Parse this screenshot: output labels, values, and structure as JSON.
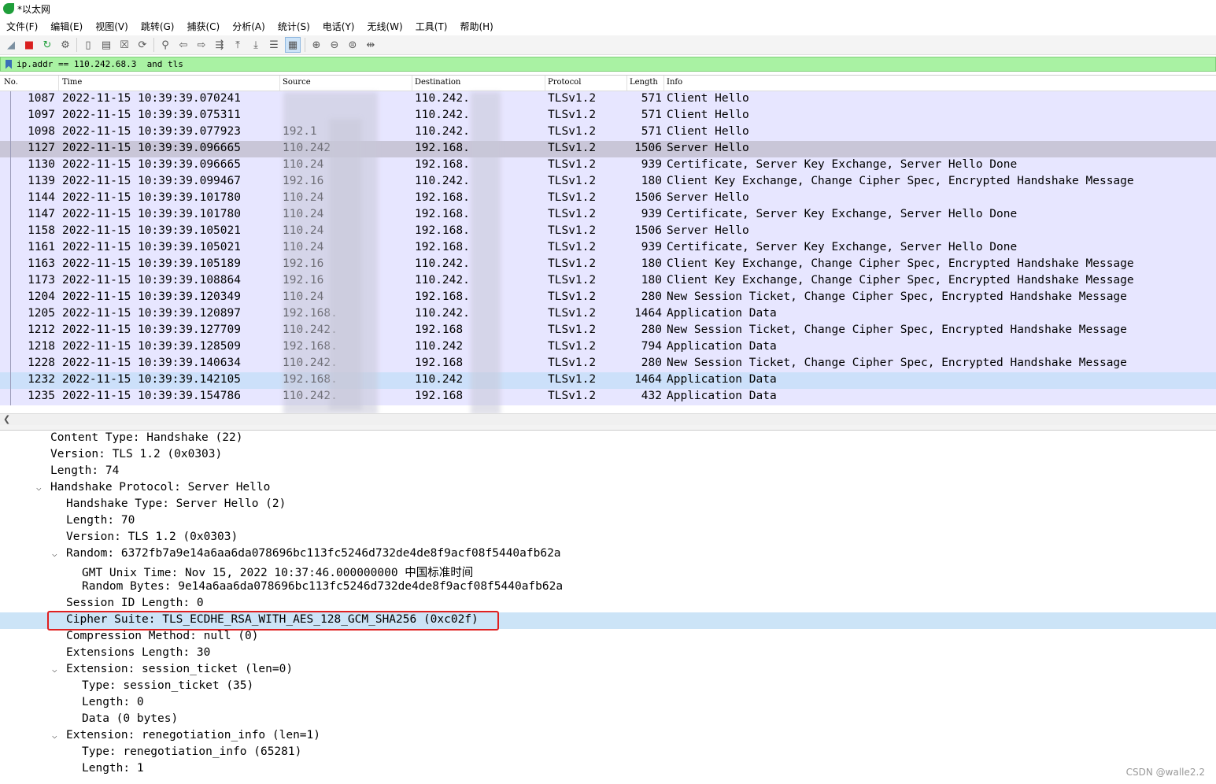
{
  "window": {
    "title": "*以太网"
  },
  "menu": [
    "文件(F)",
    "编辑(E)",
    "视图(V)",
    "跳转(G)",
    "捕获(C)",
    "分析(A)",
    "统计(S)",
    "电话(Y)",
    "无线(W)",
    "工具(T)",
    "帮助(H)"
  ],
  "toolbar": {
    "icons": [
      "shark-fin-start-icon",
      "stop-icon",
      "restart-icon",
      "options-gear-icon",
      "open-file-icon",
      "save-file-icon",
      "close-file-icon",
      "reload-icon",
      "find-icon",
      "back-arrow-icon",
      "forward-arrow-icon",
      "go-to-packet-icon",
      "first-packet-icon",
      "last-packet-icon",
      "autoscroll-icon",
      "colorize-icon",
      "zoom-in-icon",
      "zoom-out-icon",
      "zoom-normal-icon",
      "resize-columns-icon"
    ]
  },
  "filter": {
    "value": "ip.addr == 110.242.68.3  and tls"
  },
  "columns": {
    "no": "No.",
    "time": "Time",
    "source": "Source",
    "destination": "Destination",
    "protocol": "Protocol",
    "length": "Length",
    "info": "Info"
  },
  "packets": [
    {
      "no": "1087",
      "time": "2022-11-15 10:39:39.070241",
      "src": "",
      "dst": "110.242.",
      "proto": "TLSv1.2",
      "len": "571",
      "info": "Client Hello"
    },
    {
      "no": "1097",
      "time": "2022-11-15 10:39:39.075311",
      "src": "",
      "dst": "110.242.",
      "proto": "TLSv1.2",
      "len": "571",
      "info": "Client Hello"
    },
    {
      "no": "1098",
      "time": "2022-11-15 10:39:39.077923",
      "src": "192.1",
      "dst": "110.242.",
      "proto": "TLSv1.2",
      "len": "571",
      "info": "Client Hello"
    },
    {
      "no": "1127",
      "time": "2022-11-15 10:39:39.096665",
      "src": "110.242",
      "dst": "192.168.",
      "proto": "TLSv1.2",
      "len": "1506",
      "info": "Server Hello"
    },
    {
      "no": "1130",
      "time": "2022-11-15 10:39:39.096665",
      "src": "110.24",
      "dst": "192.168.",
      "proto": "TLSv1.2",
      "len": "939",
      "info": "Certificate, Server Key Exchange, Server Hello Done"
    },
    {
      "no": "1139",
      "time": "2022-11-15 10:39:39.099467",
      "src": "192.16",
      "dst": "110.242.",
      "proto": "TLSv1.2",
      "len": "180",
      "info": "Client Key Exchange, Change Cipher Spec, Encrypted Handshake Message"
    },
    {
      "no": "1144",
      "time": "2022-11-15 10:39:39.101780",
      "src": "110.24",
      "dst": "192.168.",
      "proto": "TLSv1.2",
      "len": "1506",
      "info": "Server Hello"
    },
    {
      "no": "1147",
      "time": "2022-11-15 10:39:39.101780",
      "src": "110.24",
      "dst": "192.168.",
      "proto": "TLSv1.2",
      "len": "939",
      "info": "Certificate, Server Key Exchange, Server Hello Done"
    },
    {
      "no": "1158",
      "time": "2022-11-15 10:39:39.105021",
      "src": "110.24",
      "dst": "192.168.",
      "proto": "TLSv1.2",
      "len": "1506",
      "info": "Server Hello"
    },
    {
      "no": "1161",
      "time": "2022-11-15 10:39:39.105021",
      "src": "110.24",
      "dst": "192.168.",
      "proto": "TLSv1.2",
      "len": "939",
      "info": "Certificate, Server Key Exchange, Server Hello Done"
    },
    {
      "no": "1163",
      "time": "2022-11-15 10:39:39.105189",
      "src": "192.16",
      "dst": "110.242.",
      "proto": "TLSv1.2",
      "len": "180",
      "info": "Client Key Exchange, Change Cipher Spec, Encrypted Handshake Message"
    },
    {
      "no": "1173",
      "time": "2022-11-15 10:39:39.108864",
      "src": "192.16",
      "dst": "110.242.",
      "proto": "TLSv1.2",
      "len": "180",
      "info": "Client Key Exchange, Change Cipher Spec, Encrypted Handshake Message"
    },
    {
      "no": "1204",
      "time": "2022-11-15 10:39:39.120349",
      "src": "110.24",
      "dst": "192.168.",
      "proto": "TLSv1.2",
      "len": "280",
      "info": "New Session Ticket, Change Cipher Spec, Encrypted Handshake Message"
    },
    {
      "no": "1205",
      "time": "2022-11-15 10:39:39.120897",
      "src": "192.168.",
      "dst": "110.242.",
      "proto": "TLSv1.2",
      "len": "1464",
      "info": "Application Data"
    },
    {
      "no": "1212",
      "time": "2022-11-15 10:39:39.127709",
      "src": "110.242.",
      "dst": "192.168",
      "proto": "TLSv1.2",
      "len": "280",
      "info": "New Session Ticket, Change Cipher Spec, Encrypted Handshake Message"
    },
    {
      "no": "1218",
      "time": "2022-11-15 10:39:39.128509",
      "src": "192.168.",
      "dst": "110.242",
      "proto": "TLSv1.2",
      "len": "794",
      "info": "Application Data"
    },
    {
      "no": "1228",
      "time": "2022-11-15 10:39:39.140634",
      "src": "110.242.",
      "dst": "192.168",
      "proto": "TLSv1.2",
      "len": "280",
      "info": "New Session Ticket, Change Cipher Spec, Encrypted Handshake Message"
    },
    {
      "no": "1232",
      "time": "2022-11-15 10:39:39.142105",
      "src": "192.168.",
      "dst": "110.242",
      "proto": "TLSv1.2",
      "len": "1464",
      "info": "Application Data"
    },
    {
      "no": "1235",
      "time": "2022-11-15 10:39:39.154786",
      "src": "110.242.",
      "dst": "192.168",
      "proto": "TLSv1.2",
      "len": "432",
      "info": "Application Data"
    }
  ],
  "details": [
    {
      "indent": 0,
      "expand": "",
      "text": "Content Type: Handshake (22)"
    },
    {
      "indent": 0,
      "expand": "",
      "text": "Version: TLS 1.2 (0x0303)"
    },
    {
      "indent": 0,
      "expand": "",
      "text": "Length: 74"
    },
    {
      "indent": 0,
      "expand": "v",
      "text": "Handshake Protocol: Server Hello"
    },
    {
      "indent": 1,
      "expand": "",
      "text": "Handshake Type: Server Hello (2)"
    },
    {
      "indent": 1,
      "expand": "",
      "text": "Length: 70"
    },
    {
      "indent": 1,
      "expand": "",
      "text": "Version: TLS 1.2 (0x0303)"
    },
    {
      "indent": 1,
      "expand": "v",
      "text": "Random: 6372fb7a9e14a6aa6da078696bc113fc5246d732de4de8f9acf08f5440afb62a"
    },
    {
      "indent": 2,
      "expand": "",
      "text": "GMT Unix Time: Nov 15, 2022 10:37:46.000000000 中国标准时间"
    },
    {
      "indent": 2,
      "expand": "",
      "text": "Random Bytes: 9e14a6aa6da078696bc113fc5246d732de4de8f9acf08f5440afb62a"
    },
    {
      "indent": 1,
      "expand": "",
      "text": "Session ID Length: 0"
    },
    {
      "indent": 1,
      "expand": "",
      "text": "Cipher Suite: TLS_ECDHE_RSA_WITH_AES_128_GCM_SHA256 (0xc02f)",
      "highlight": true
    },
    {
      "indent": 1,
      "expand": "",
      "text": "Compression Method: null (0)"
    },
    {
      "indent": 1,
      "expand": "",
      "text": "Extensions Length: 30"
    },
    {
      "indent": 1,
      "expand": "v",
      "text": "Extension: session_ticket (len=0)"
    },
    {
      "indent": 2,
      "expand": "",
      "text": "Type: session_ticket (35)"
    },
    {
      "indent": 2,
      "expand": "",
      "text": "Length: 0"
    },
    {
      "indent": 2,
      "expand": "",
      "text": "Data (0 bytes)"
    },
    {
      "indent": 1,
      "expand": "v",
      "text": "Extension: renegotiation_info (len=1)"
    },
    {
      "indent": 2,
      "expand": "",
      "text": "Type: renegotiation_info (65281)"
    },
    {
      "indent": 2,
      "expand": "",
      "text": "Length: 1"
    }
  ],
  "watermark": "CSDN @walle2.2",
  "colors": {
    "filter_bg": "#a9f2a3",
    "row_bg": "#e7e6ff",
    "selected_row": "#c9c6d8",
    "highlight": "#cce4f7",
    "annotation_box": "#e02020"
  }
}
